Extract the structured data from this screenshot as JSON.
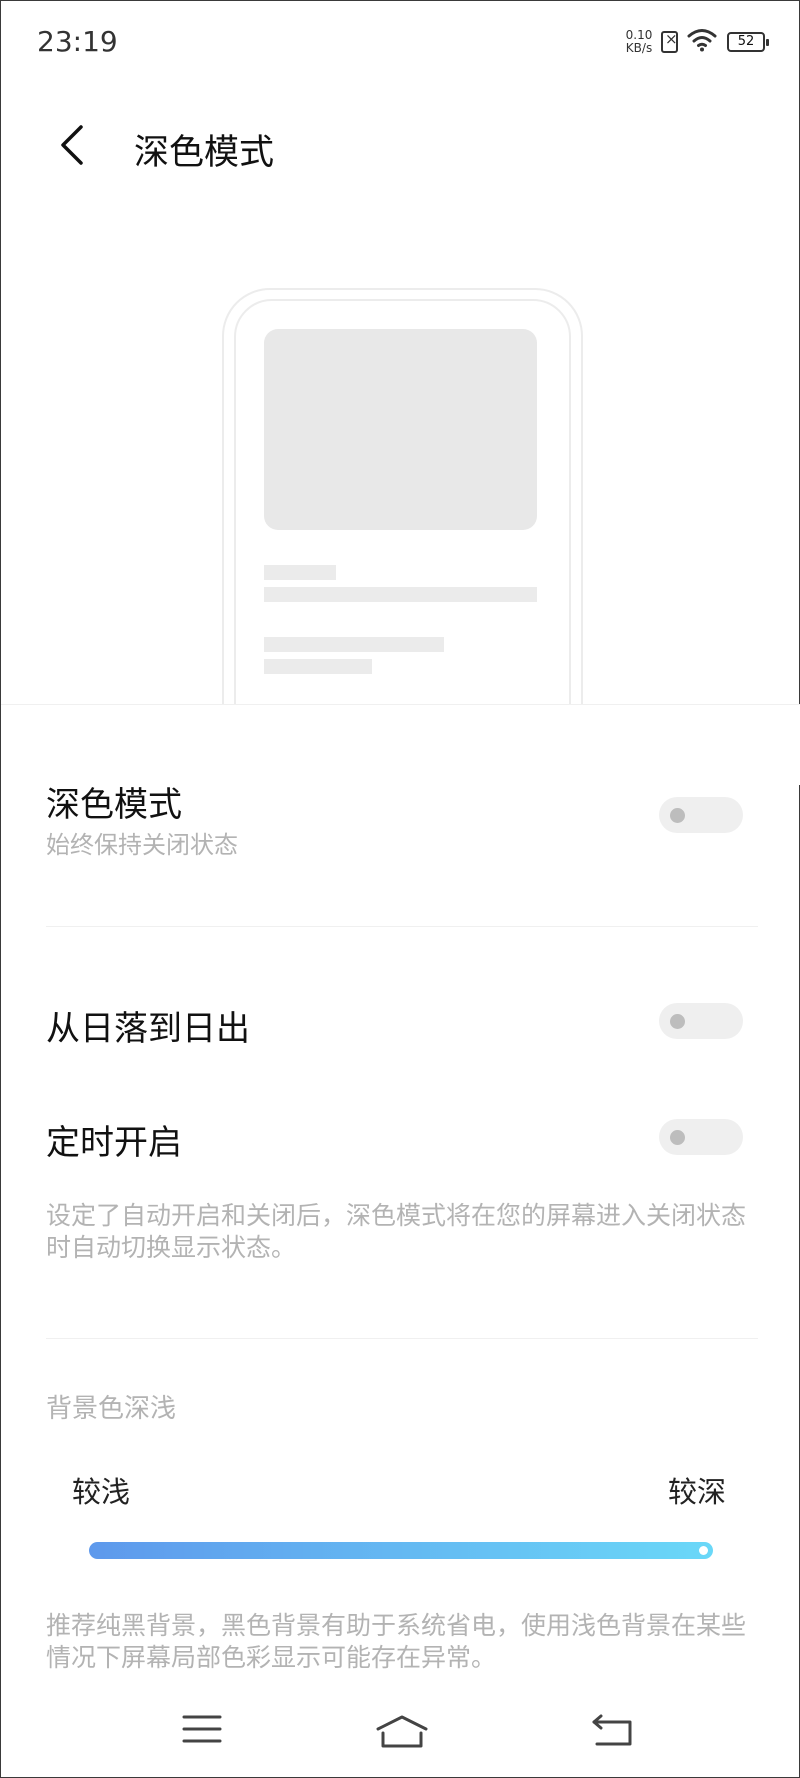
{
  "status_bar": {
    "time": "23:19",
    "net_speed_value": "0.10",
    "net_speed_unit": "KB/s",
    "battery": "52"
  },
  "header": {
    "title": "深色模式"
  },
  "settings": {
    "dark_mode": {
      "label": "深色模式",
      "subtitle": "始终保持关闭状态",
      "enabled": false
    },
    "sunset_to_sunrise": {
      "label": "从日落到日出",
      "enabled": false
    },
    "scheduled": {
      "label": "定时开启",
      "enabled": false
    },
    "schedule_note": "设定了自动开启和关闭后，深色模式将在您的屏幕进入关闭状态时自动切换显示状态。"
  },
  "background_depth": {
    "section_title": "背景色深浅",
    "min_label": "较浅",
    "max_label": "较深",
    "level_percent": 100,
    "note": "推荐纯黑背景，黑色背景有助于系统省电，使用浅色背景在某些情况下屏幕局部色彩显示可能存在异常。"
  },
  "navigation": {
    "icons": [
      "menu-icon",
      "home-icon",
      "back-icon"
    ]
  },
  "colors": {
    "slider_start": "#5e99ec",
    "slider_end": "#6ad8f8",
    "toggle_off_track": "#efefef",
    "toggle_off_knob": "#bdbdbd",
    "secondary_text": "#b3b3b3"
  }
}
